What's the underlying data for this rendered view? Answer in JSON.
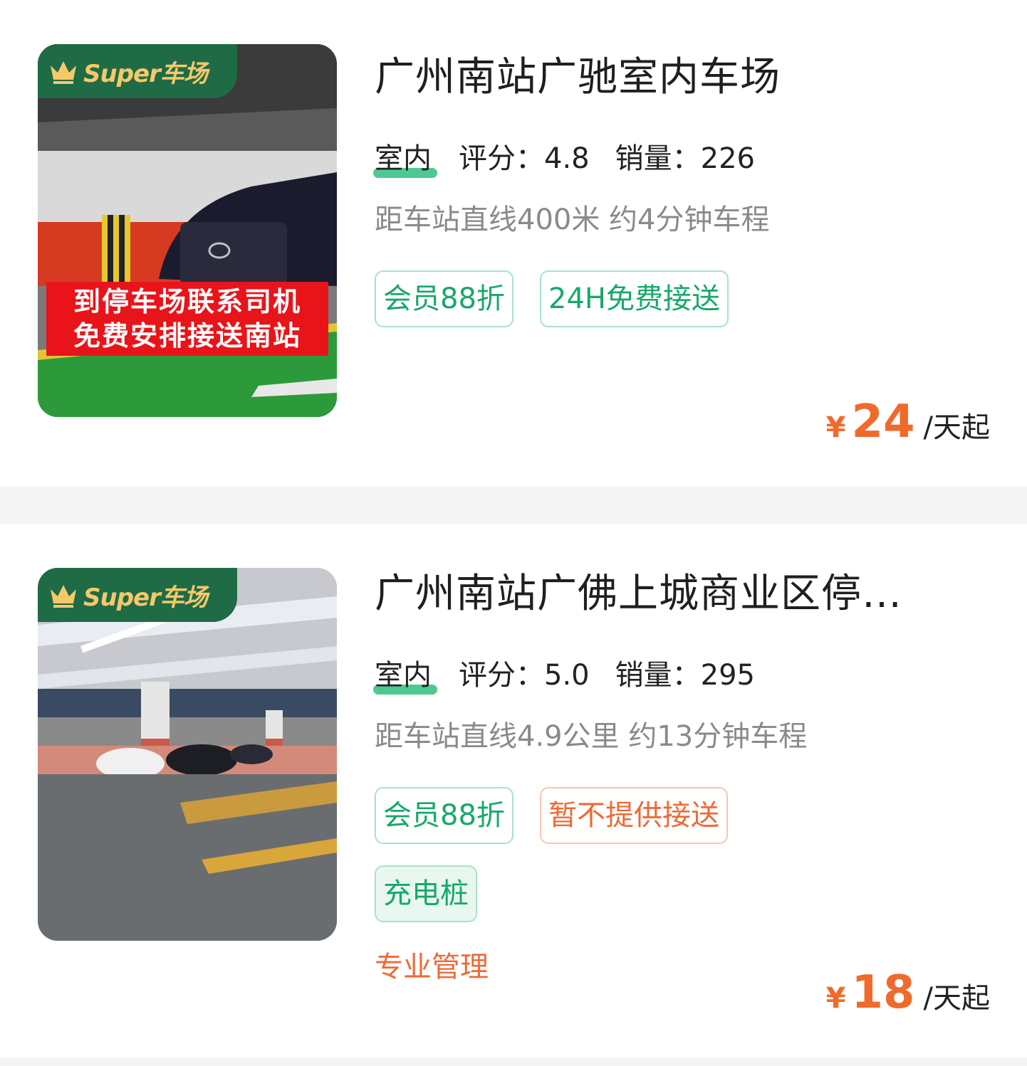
{
  "listings": [
    {
      "badge": "Super车场",
      "image_overlay": [
        "到停车场联系司机",
        "免费安排接送南站"
      ],
      "title": "广州南站广驰室内车场",
      "type": "室内",
      "rating_label": "评分：4.8",
      "sales_label": "销量：226",
      "distance": "距车站直线400米 约4分钟车程",
      "tags": [
        "会员88折",
        "24H免费接送"
      ],
      "currency": "¥",
      "price": "24",
      "price_unit": "/天起"
    },
    {
      "badge": "Super车场",
      "title": "广州南站广佛上城商业区停…",
      "type": "室内",
      "rating_label": "评分：5.0",
      "sales_label": "销量：295",
      "distance": "距车站直线4.9公里 约13分钟车程",
      "tags": [
        "会员88折",
        "暂不提供接送",
        "充电桩"
      ],
      "management": "专业管理",
      "currency": "¥",
      "price": "18",
      "price_unit": "/天起"
    }
  ],
  "colors": {
    "brand_green": "#1e6b45",
    "tag_green": "#17a86a",
    "tag_orange": "#ee6a35",
    "price_orange": "#f06a2c",
    "overlay_red": "#e8141a"
  },
  "icons": [
    "crown-icon"
  ]
}
